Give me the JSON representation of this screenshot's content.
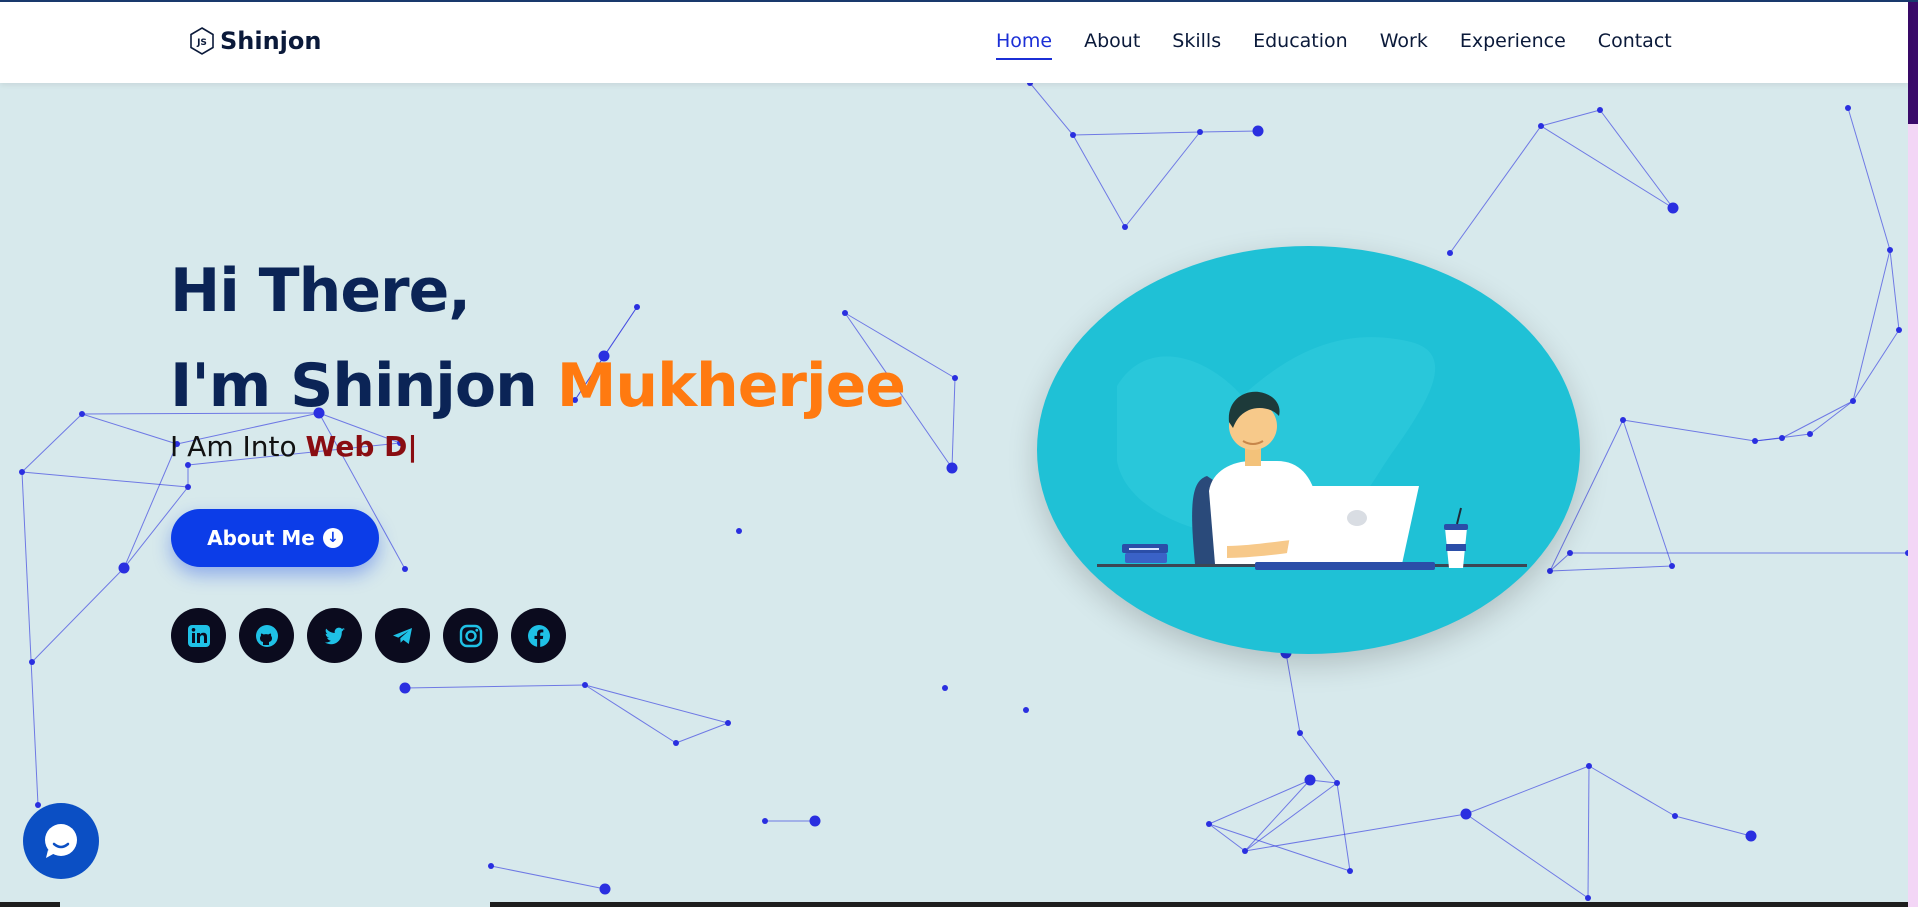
{
  "brand": {
    "name": "Shinjon",
    "logo_icon": "nodejs-hexagon-icon"
  },
  "nav": {
    "items": [
      {
        "label": "Home",
        "active": true
      },
      {
        "label": "About",
        "active": false
      },
      {
        "label": "Skills",
        "active": false
      },
      {
        "label": "Education",
        "active": false
      },
      {
        "label": "Work",
        "active": false
      },
      {
        "label": "Experience",
        "active": false
      },
      {
        "label": "Contact",
        "active": false
      }
    ]
  },
  "hero": {
    "greeting": "Hi There,",
    "intro_prefix": "I'm Shinjon ",
    "intro_accent": "Mukherjee",
    "typing_prefix": "I Am Into ",
    "typing_value": "Web D|",
    "button_label": "About Me",
    "button_icon": "arrow-down-circle-icon",
    "illustration": "developer-at-laptop-illustration"
  },
  "socials": [
    {
      "name": "linkedin",
      "icon": "linkedin-icon"
    },
    {
      "name": "github",
      "icon": "github-icon"
    },
    {
      "name": "twitter",
      "icon": "twitter-icon"
    },
    {
      "name": "telegram",
      "icon": "telegram-icon"
    },
    {
      "name": "instagram",
      "icon": "instagram-icon"
    },
    {
      "name": "facebook",
      "icon": "facebook-icon"
    }
  ],
  "chat": {
    "icon": "chat-bubble-icon"
  },
  "colors": {
    "background": "#d7e9ec",
    "navy": "#0b2456",
    "accent_orange": "#ff7a10",
    "typed_red": "#8a0d12",
    "primary_blue": "#0c3de8",
    "nav_active": "#1b2fd6",
    "illustration_bg": "#1fc1d6",
    "particle": "#2a2fe0"
  }
}
